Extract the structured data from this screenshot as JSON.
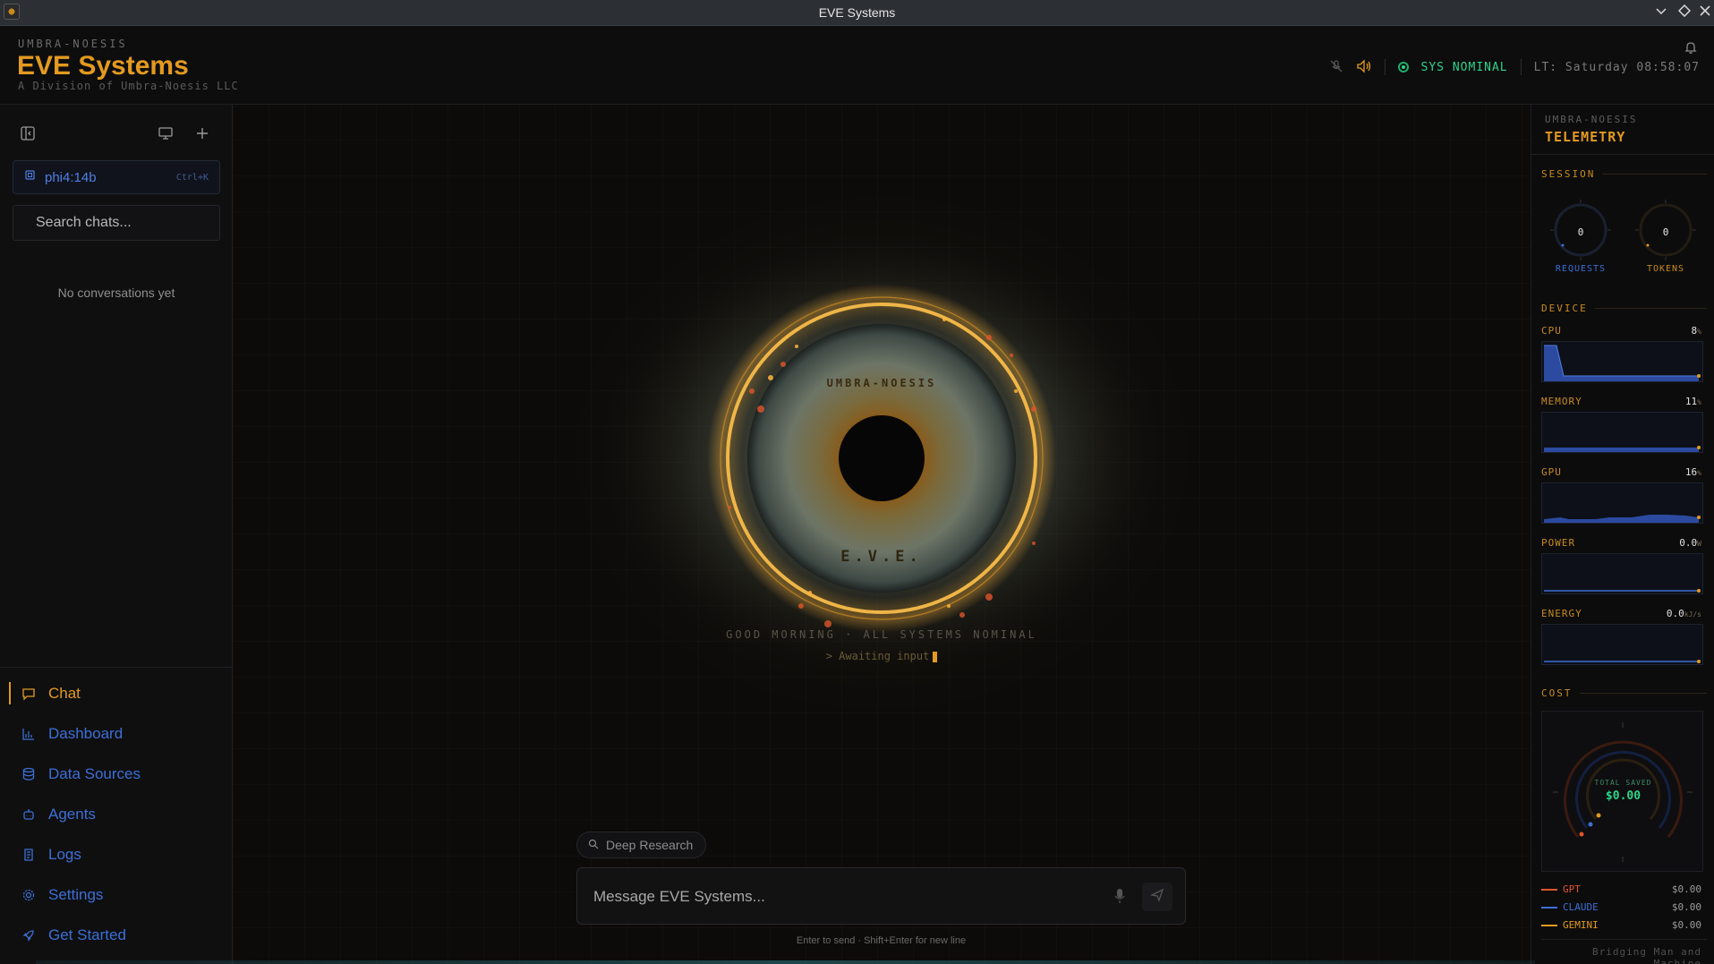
{
  "window": {
    "title": "EVE Systems"
  },
  "header": {
    "brand_top": "UMBRA-NOESIS",
    "brand_main": "EVE Systems",
    "brand_sub": "A Division of Umbra-Noesis LLC",
    "status": "SYS NOMINAL",
    "local_time": "LT: Saturday 08:58:07",
    "colors": {
      "accent": "#e39a1f",
      "status": "#2ed389"
    }
  },
  "sidebar": {
    "model": "phi4:14b",
    "model_shortcut": "Ctrl+K",
    "search_placeholder": "Search chats...",
    "empty_message": "No conversations yet",
    "nav": [
      {
        "label": "Chat",
        "icon": "chat-bubble-icon",
        "active": true
      },
      {
        "label": "Dashboard",
        "icon": "bar-chart-icon"
      },
      {
        "label": "Data Sources",
        "icon": "database-icon"
      },
      {
        "label": "Agents",
        "icon": "robot-icon"
      },
      {
        "label": "Logs",
        "icon": "scroll-icon"
      },
      {
        "label": "Settings",
        "icon": "gear-icon"
      },
      {
        "label": "Get Started",
        "icon": "rocket-icon"
      }
    ]
  },
  "main": {
    "eye_top_text": "UMBRA-NOESIS",
    "eye_bottom_text": "E.V.E.",
    "greeting": "GOOD MORNING · ALL SYSTEMS NOMINAL",
    "awaiting": "> Awaiting input",
    "deep_research": "Deep Research",
    "message_placeholder": "Message EVE Systems...",
    "hint": "Enter to send · Shift+Enter for new line"
  },
  "telemetry": {
    "top": "UMBRA-NOESIS",
    "title": "TELEMETRY",
    "session_label": "SESSION",
    "requests": {
      "label": "REQUESTS",
      "value": "0"
    },
    "tokens": {
      "label": "TOKENS",
      "value": "0"
    },
    "device_label": "DEVICE",
    "cpu": {
      "label": "CPU",
      "value": "8",
      "unit": "%"
    },
    "memory": {
      "label": "MEMORY",
      "value": "11",
      "unit": "%"
    },
    "gpu": {
      "label": "GPU",
      "value": "16",
      "unit": "%"
    },
    "power": {
      "label": "POWER",
      "value": "0.0",
      "unit": "W"
    },
    "energy": {
      "label": "ENERGY",
      "value": "0.0",
      "unit": "kJ/s"
    },
    "cost_label": "COST",
    "total_saved_label": "TOTAL SAVED",
    "total_saved": "$0.00",
    "providers": [
      {
        "name": "GPT",
        "value": "$0.00",
        "color": "#e0552a"
      },
      {
        "name": "CLAUDE",
        "value": "$0.00",
        "color": "#3d6fd6"
      },
      {
        "name": "GEMINI",
        "value": "$0.00",
        "color": "#e39a1f"
      }
    ],
    "footer": "Bridging Man and Machine"
  }
}
